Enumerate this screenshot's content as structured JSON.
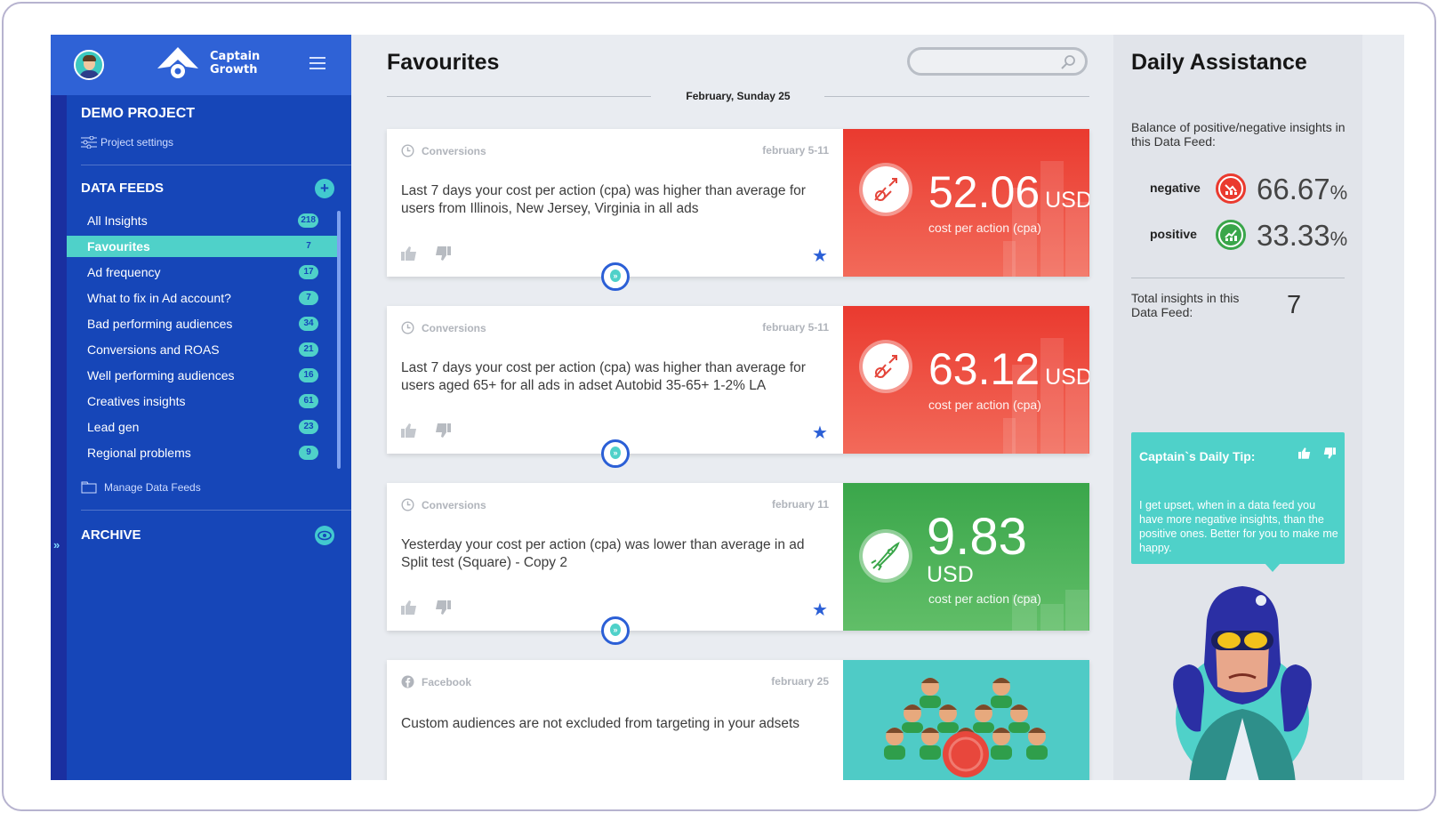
{
  "app": {
    "logo_line1": "Captain",
    "logo_line2": "Growth"
  },
  "sidebar": {
    "project_title": "DEMO PROJECT",
    "project_settings": "Project settings",
    "data_feeds_title": "DATA FEEDS",
    "feeds": [
      {
        "label": "All Insights",
        "count": "218"
      },
      {
        "label": "Favourites",
        "count": "7"
      },
      {
        "label": "Ad frequency",
        "count": "17"
      },
      {
        "label": "What to fix in Ad account?",
        "count": "7"
      },
      {
        "label": "Bad performing audiences",
        "count": "34"
      },
      {
        "label": "Conversions and ROAS",
        "count": "21"
      },
      {
        "label": "Well performing audiences",
        "count": "16"
      },
      {
        "label": "Creatives insights",
        "count": "61"
      },
      {
        "label": "Lead gen",
        "count": "23"
      },
      {
        "label": "Regional problems",
        "count": "9"
      }
    ],
    "manage": "Manage Data Feeds",
    "archive_title": "ARCHIVE"
  },
  "main": {
    "title": "Favourites",
    "search_placeholder": "",
    "date_label": "February, Sunday 25",
    "cards": [
      {
        "category": "Conversions",
        "date": "february 5-11",
        "text": "Last 7 days your cost per action (cpa) was higher than average for users from Illinois, New Jersey, Virginia in all ads",
        "value": "52.06",
        "unit": "USD",
        "metric": "cost per action (cpa)",
        "color": "#ea3a2f"
      },
      {
        "category": "Conversions",
        "date": "february 5-11",
        "text": "Last 7 days your cost per action (cpa) was higher than average for users aged 65+ for all ads in adset Autobid 35-65+ 1-2% LA",
        "value": "63.12",
        "unit": "USD",
        "metric": "cost per action (cpa)",
        "color": "#ea3a2f"
      },
      {
        "category": "Conversions",
        "date": "february 11",
        "text": "Yesterday your cost per action (cpa) was lower than average in ad Split test (Square) - Copy 2",
        "value": "9.83",
        "unit": "USD",
        "metric": "cost per action (cpa)",
        "color": "#3aa64a"
      },
      {
        "category": "Facebook",
        "date": "february 25",
        "text": "Custom audiences are not excluded from targeting in your adsets",
        "color": "#4fcbc6"
      }
    ]
  },
  "right": {
    "title": "Daily Assistance",
    "balance_text": "Balance of positive/negative insights in this Data Feed:",
    "negative_label": "negative",
    "negative_value": "66.67",
    "positive_label": "positive",
    "positive_value": "33.33",
    "percent": "%",
    "total_text": "Total insights in this Data Feed:",
    "total_value": "7",
    "tip_title": "Captain`s Daily Tip:",
    "tip_text": "I get upset, when in a data feed you have more negative insights, than the positive ones. Better for you to make me happy."
  }
}
